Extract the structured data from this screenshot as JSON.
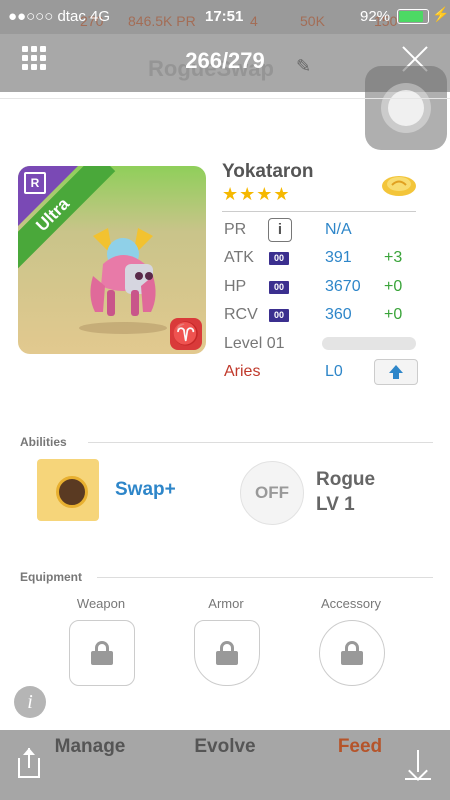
{
  "status_bar": {
    "carrier": "●●○○○ dtac 4G",
    "time": "17:51",
    "battery_percent": "92%",
    "battery_level": 0.92,
    "bg_counts": [
      "270",
      "846.5K PR",
      "4",
      "50K",
      "150"
    ]
  },
  "header": {
    "counter": "266/279",
    "title": "RogueSwap"
  },
  "monster": {
    "name": "Yokataron",
    "stars": "★★★★",
    "rarity": "Ultra",
    "rarity_badge": "R",
    "zodiac_symbol": "♈",
    "colors": {
      "ribbon": "#4aa83a",
      "corner": "#7a49b5",
      "sign": "#d93a3a"
    }
  },
  "stats": {
    "pr": {
      "label": "PR",
      "value": "N/A"
    },
    "atk": {
      "label": "ATK",
      "tag": "00",
      "value": "391",
      "bonus": "+3"
    },
    "hp": {
      "label": "HP",
      "tag": "00",
      "value": "3670",
      "bonus": "+0"
    },
    "rcv": {
      "label": "RCV",
      "tag": "00",
      "value": "360",
      "bonus": "+0"
    },
    "level": {
      "label": "Level 01",
      "progress": 0.0
    },
    "zodiac": {
      "label": "Aries",
      "value": "L0"
    }
  },
  "abilities": {
    "title": "Abilities",
    "primary": "Swap+",
    "secondary_state": "OFF",
    "secondary_name": "Rogue",
    "secondary_level": "LV 1"
  },
  "equipment": {
    "title": "Equipment",
    "slots": [
      "Weapon",
      "Armor",
      "Accessory"
    ]
  },
  "actions": {
    "manage": "Manage",
    "evolve": "Evolve",
    "feed": "Feed"
  },
  "info_glyph": "i"
}
